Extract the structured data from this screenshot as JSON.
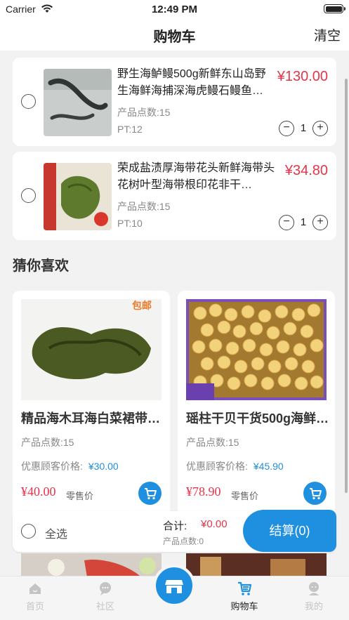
{
  "status": {
    "carrier": "Carrier",
    "time": "12:49 PM"
  },
  "nav": {
    "title": "购物车",
    "clear": "清空"
  },
  "cart_items": [
    {
      "name": "野生海鲈鳗500g新鲜东山岛野生海鲜海捕深海虎鳗石鳗鱼…",
      "price": "¥130.00",
      "points": "产品点数:15",
      "pt": "PT:12",
      "qty": "1",
      "minus": "−",
      "plus": "+"
    },
    {
      "name": "荣成盐渍厚海带花头新鲜海带头花树叶型海带根印花非干…",
      "price": "¥34.80",
      "points": "产品点数:15",
      "pt": "PT:10",
      "qty": "1",
      "minus": "−",
      "plus": "+"
    }
  ],
  "recommend": {
    "title": "猜你喜欢",
    "products": [
      {
        "name": "精品海木耳海白菜裙带…",
        "points": "产品点数:15",
        "vip_label": "优惠顾客价格:",
        "vip_price": "¥30.00",
        "retail_price": "¥40.00",
        "retail_label": "零售价",
        "badge": "包邮"
      },
      {
        "name": "瑶柱干贝干货500g海鲜…",
        "points": "产品点数:15",
        "vip_label": "优惠顾客价格:",
        "vip_price": "¥45.90",
        "retail_price": "¥78.90",
        "retail_label": "零售价"
      }
    ]
  },
  "checkout": {
    "select_all": "全选",
    "total_label": "合计:",
    "total_value": "¥0.00",
    "points_label": "产品点数:0",
    "button": "结算(0)"
  },
  "tabs": [
    {
      "label": "首页",
      "icon": "home-icon"
    },
    {
      "label": "社区",
      "icon": "chat-icon"
    },
    {
      "label": "购物车",
      "icon": "cart-icon",
      "active": true
    },
    {
      "label": "我的",
      "icon": "profile-icon"
    }
  ],
  "colors": {
    "accent": "#1f8fe0",
    "price": "#e8344a"
  }
}
